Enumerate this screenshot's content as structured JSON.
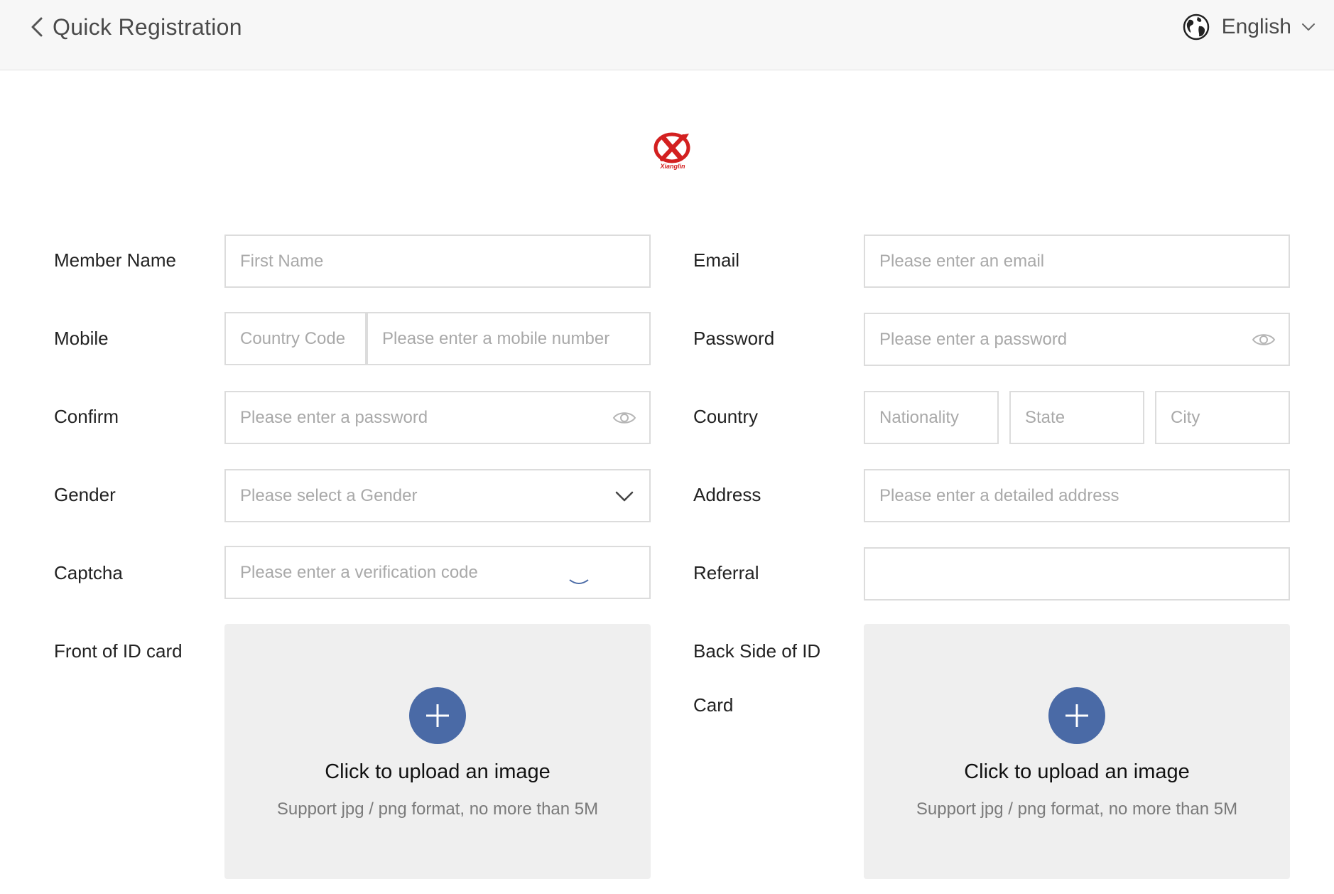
{
  "header": {
    "title": "Quick Registration",
    "language": "English"
  },
  "logo": {
    "text": "Xianglin"
  },
  "form": {
    "member_name": {
      "label": "Member Name",
      "placeholder": "First Name"
    },
    "email": {
      "label": "Email",
      "placeholder": "Please enter an email"
    },
    "mobile": {
      "label": "Mobile",
      "code_placeholder": "Country Code",
      "placeholder": "Please enter a mobile number"
    },
    "password": {
      "label": "Password",
      "placeholder": "Please enter a password"
    },
    "confirm": {
      "label": "Confirm",
      "placeholder": "Please enter a password"
    },
    "country": {
      "label": "Country",
      "nationality_placeholder": "Nationality",
      "state_placeholder": "State",
      "city_placeholder": "City"
    },
    "gender": {
      "label": "Gender",
      "placeholder": "Please select a Gender"
    },
    "address": {
      "label": "Address",
      "placeholder": "Please enter a detailed address"
    },
    "captcha": {
      "label": "Captcha",
      "placeholder": "Please enter a verification code"
    },
    "referral": {
      "label": "Referral",
      "placeholder": ""
    },
    "id_front": {
      "label": "Front of ID card",
      "title": "Click to upload an image",
      "hint": "Support jpg / png format, no more than 5M"
    },
    "id_back": {
      "label_line1": "Back Side of ID",
      "label_line2": "Card",
      "title": "Click to upload an image",
      "hint": "Support jpg / png format, no more than 5M"
    }
  },
  "colors": {
    "accent": "#4a6aa6",
    "logo_red": "#d32020"
  }
}
